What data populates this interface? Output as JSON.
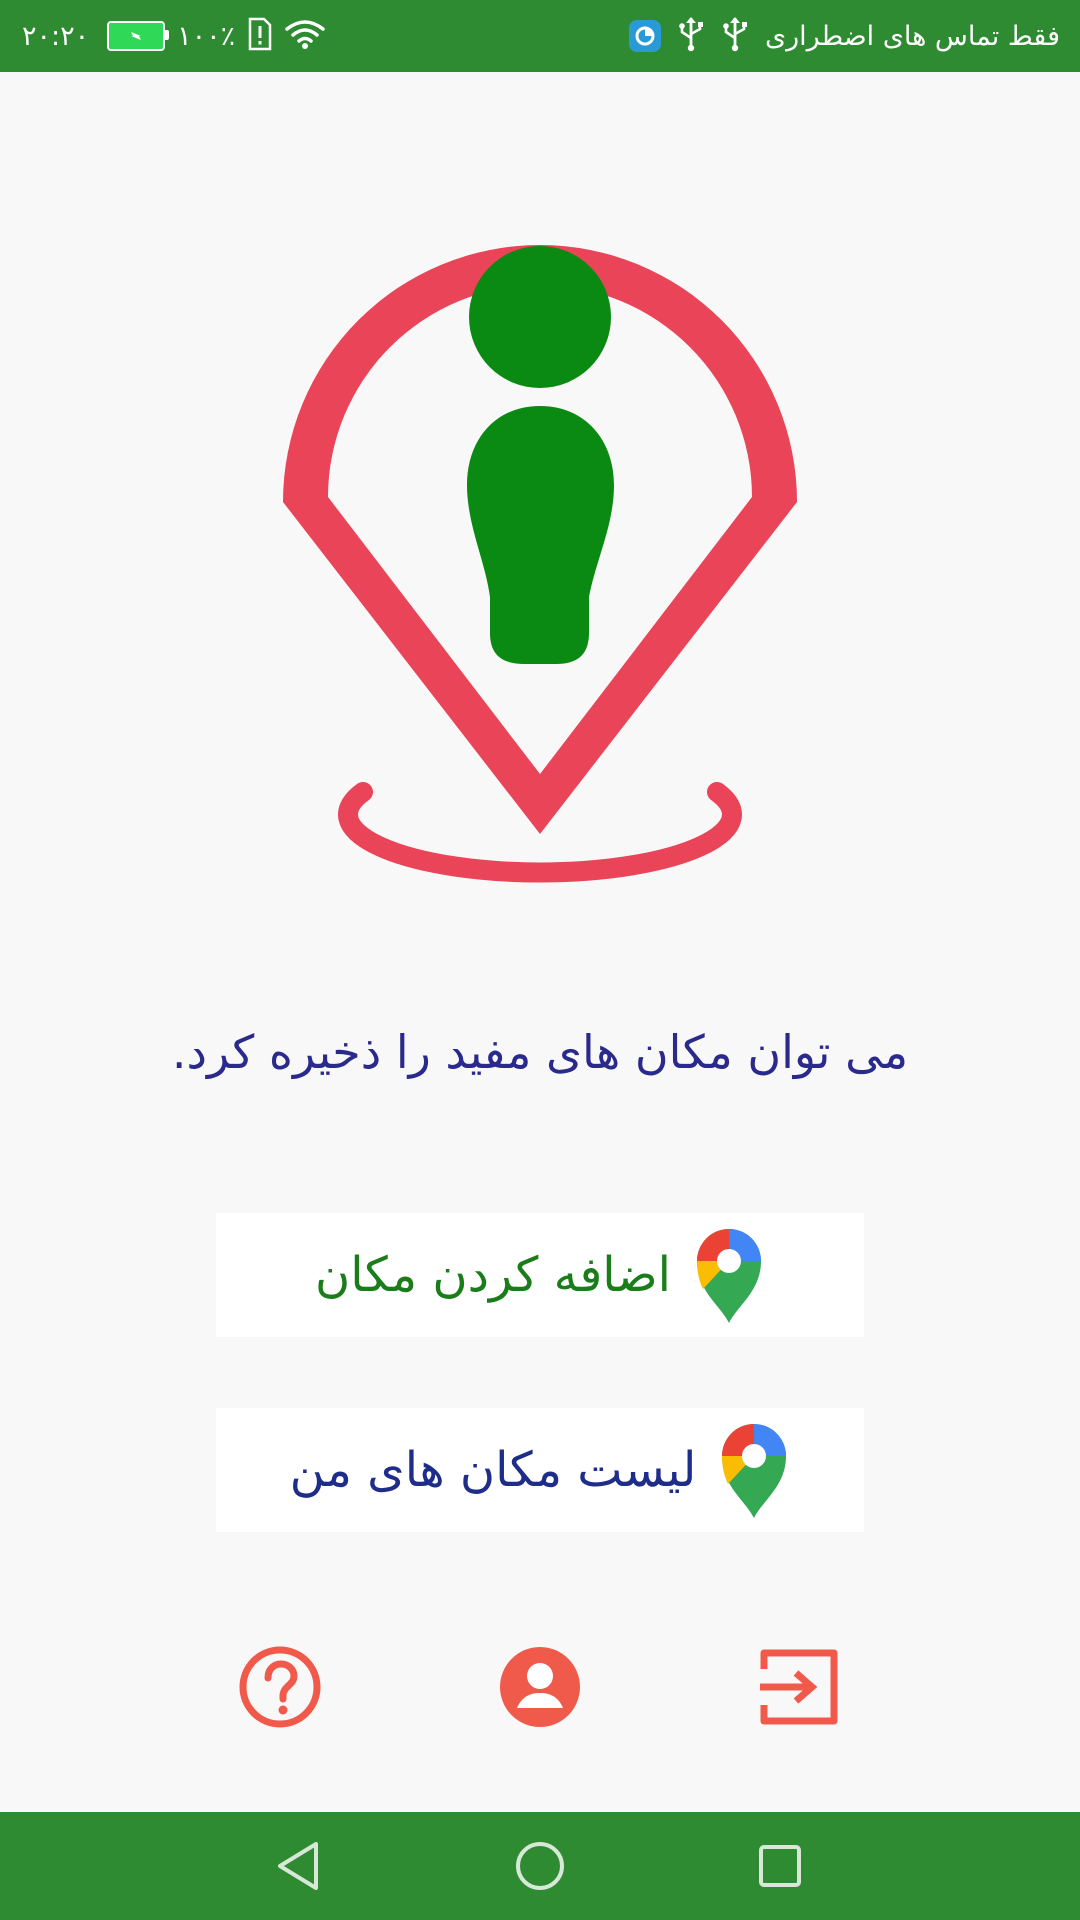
{
  "status_bar": {
    "time": "۲۰:۲۰",
    "battery_percent": "۱۰۰٪",
    "emergency_text": "فقط تماس های اضطراری",
    "icons": [
      "battery-charging-icon",
      "sim-alert-icon",
      "wifi-icon",
      "app-notification-icon",
      "usb-icon"
    ]
  },
  "hero": {
    "icon": "location-info-pin-icon",
    "pin_color": "#ea4458",
    "info_color": "#0a8a12"
  },
  "tagline": "می توان مکان های مفید را ذخیره کرد.",
  "menu": {
    "add_place_label": "اضافه کردن مکان",
    "my_places_label": "لیست مکان های من"
  },
  "toolbar": {
    "icons": [
      "help-icon",
      "profile-icon",
      "exit-icon"
    ],
    "icon_color": "#f05a4a"
  },
  "nav": {
    "icons": [
      "back-icon",
      "home-icon",
      "recents-icon"
    ]
  },
  "colors": {
    "bar_green": "#2e8b32",
    "background": "#f8f8f8"
  }
}
